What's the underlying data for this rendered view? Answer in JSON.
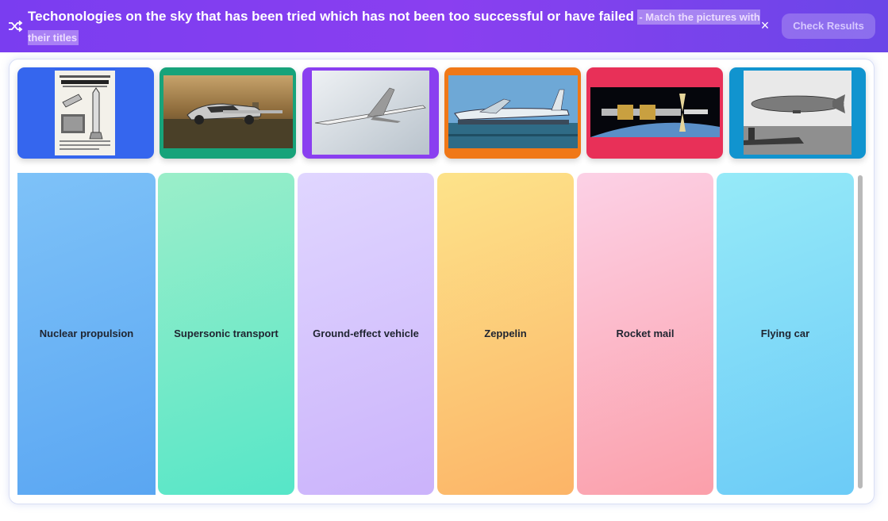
{
  "header": {
    "title": "Techonologies on the sky that has been tried which has not been too successful or have failed",
    "subtitle": "- Match the pictures with their titles",
    "close_glyph": "×",
    "check_label": "Check Results",
    "shuffle_icon": "shuffle-icon"
  },
  "cards": [
    {
      "name": "card-nuclear-rocket-document",
      "frame_color": "#3b6ff0",
      "picture": "old newspaper page with rocket"
    },
    {
      "name": "card-flying-car",
      "frame_color": "#1aa57a",
      "picture": "flying car over city"
    },
    {
      "name": "card-concorde",
      "frame_color": "#8a3cf0",
      "picture": "supersonic jet in sky"
    },
    {
      "name": "card-ekranoplan",
      "frame_color": "#f07818",
      "picture": "ground effect vehicle on water"
    },
    {
      "name": "card-nuclear-spacecraft",
      "frame_color": "#e8305a",
      "picture": "nuclear spacecraft over earth"
    },
    {
      "name": "card-zeppelin",
      "frame_color": "#1296d0",
      "picture": "zeppelin airship photo"
    }
  ],
  "drop_zones": [
    {
      "label": "Nuclear propulsion"
    },
    {
      "label": "Supersonic transport"
    },
    {
      "label": "Ground-effect vehicle"
    },
    {
      "label": "Zeppelin"
    },
    {
      "label": "Rocket mail"
    },
    {
      "label": "Flying car"
    }
  ]
}
